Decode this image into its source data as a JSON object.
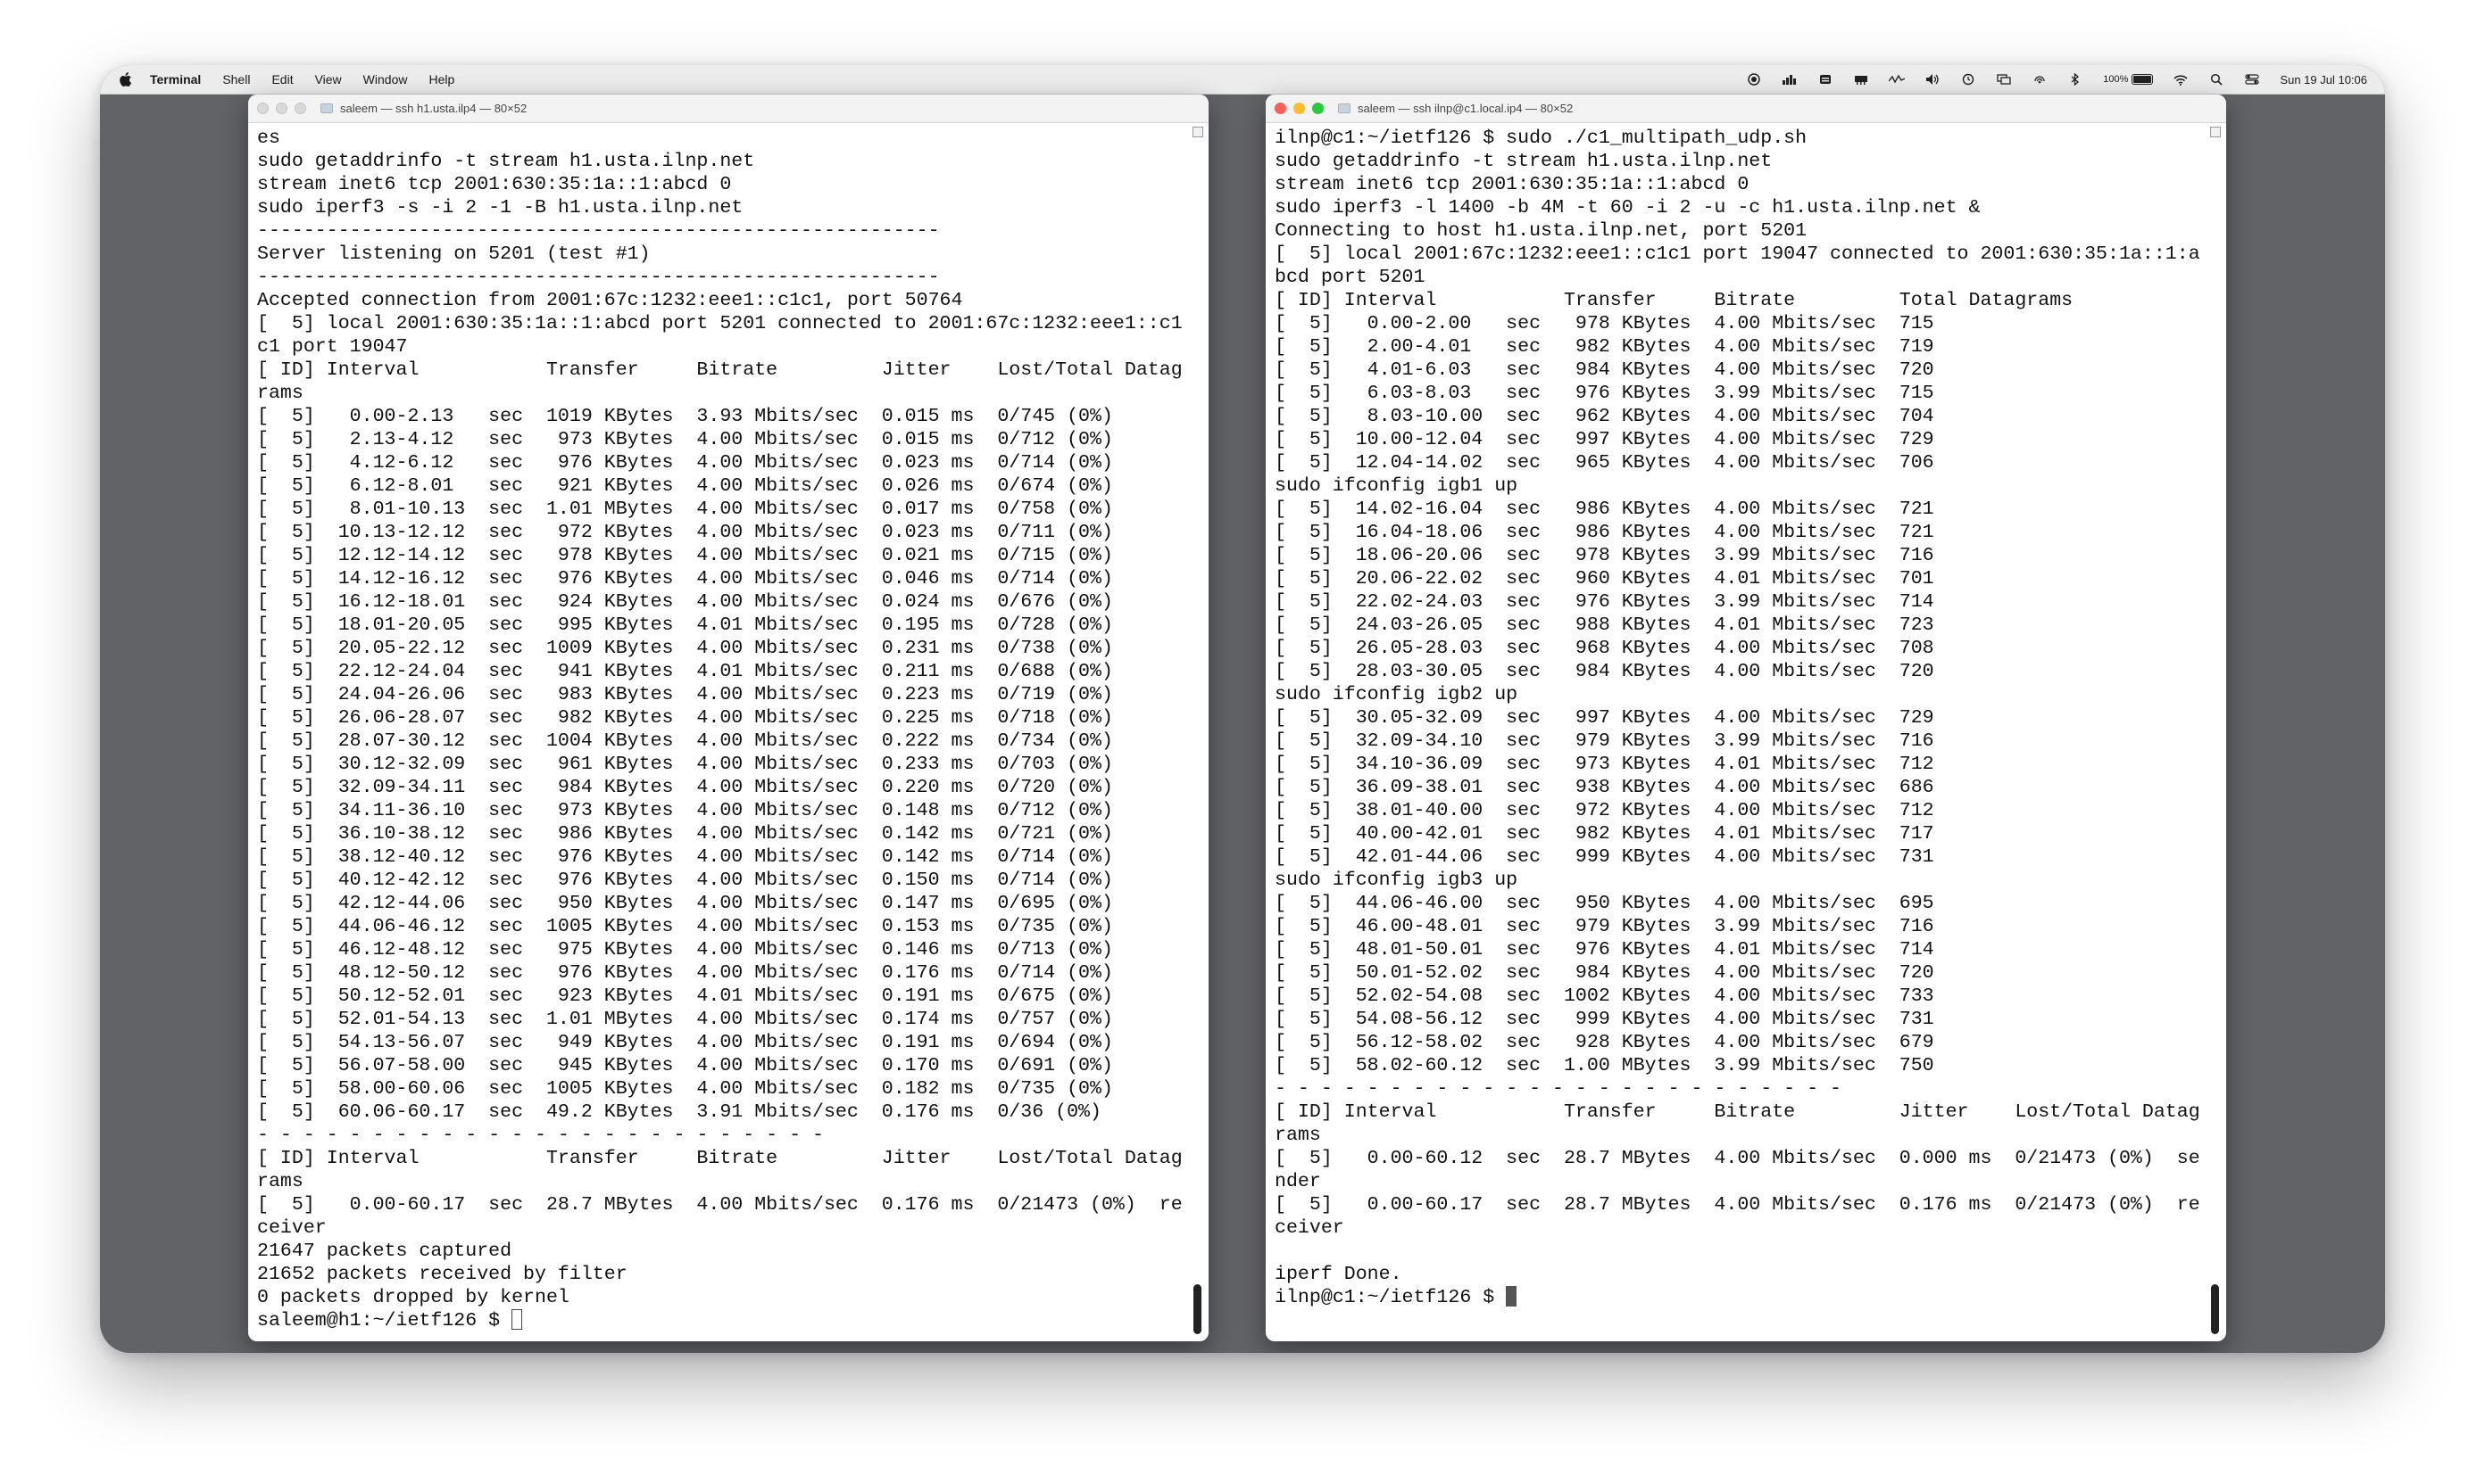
{
  "menubar": {
    "apple_icon": "apple-logo-icon",
    "items": [
      "Terminal",
      "Shell",
      "Edit",
      "View",
      "Window",
      "Help"
    ],
    "battery": "100%",
    "clock": "Sun 19 Jul  10:06"
  },
  "left_window": {
    "title": "saleem — ssh h1.usta.ilp4 — 80×52",
    "lines": [
      "es",
      "sudo getaddrinfo -t stream h1.usta.ilnp.net",
      "stream inet6 tcp 2001:630:35:1a::1:abcd 0",
      "sudo iperf3 -s -i 2 -1 -B h1.usta.ilnp.net",
      "-----------------------------------------------------------",
      "Server listening on 5201 (test #1)",
      "-----------------------------------------------------------",
      "Accepted connection from 2001:67c:1232:eee1::c1c1, port 50764",
      "[  5] local 2001:630:35:1a::1:abcd port 5201 connected to 2001:67c:1232:eee1::c1",
      "c1 port 19047",
      "[ ID] Interval           Transfer     Bitrate         Jitter    Lost/Total Datag",
      "rams",
      "[  5]   0.00-2.13   sec  1019 KBytes  3.93 Mbits/sec  0.015 ms  0/745 (0%)",
      "[  5]   2.13-4.12   sec   973 KBytes  4.00 Mbits/sec  0.015 ms  0/712 (0%)",
      "[  5]   4.12-6.12   sec   976 KBytes  4.00 Mbits/sec  0.023 ms  0/714 (0%)",
      "[  5]   6.12-8.01   sec   921 KBytes  4.00 Mbits/sec  0.026 ms  0/674 (0%)",
      "[  5]   8.01-10.13  sec  1.01 MBytes  4.00 Mbits/sec  0.017 ms  0/758 (0%)",
      "[  5]  10.13-12.12  sec   972 KBytes  4.00 Mbits/sec  0.023 ms  0/711 (0%)",
      "[  5]  12.12-14.12  sec   978 KBytes  4.00 Mbits/sec  0.021 ms  0/715 (0%)",
      "[  5]  14.12-16.12  sec   976 KBytes  4.00 Mbits/sec  0.046 ms  0/714 (0%)",
      "[  5]  16.12-18.01  sec   924 KBytes  4.00 Mbits/sec  0.024 ms  0/676 (0%)",
      "[  5]  18.01-20.05  sec   995 KBytes  4.01 Mbits/sec  0.195 ms  0/728 (0%)",
      "[  5]  20.05-22.12  sec  1009 KBytes  4.00 Mbits/sec  0.231 ms  0/738 (0%)",
      "[  5]  22.12-24.04  sec   941 KBytes  4.01 Mbits/sec  0.211 ms  0/688 (0%)",
      "[  5]  24.04-26.06  sec   983 KBytes  4.00 Mbits/sec  0.223 ms  0/719 (0%)",
      "[  5]  26.06-28.07  sec   982 KBytes  4.00 Mbits/sec  0.225 ms  0/718 (0%)",
      "[  5]  28.07-30.12  sec  1004 KBytes  4.00 Mbits/sec  0.222 ms  0/734 (0%)",
      "[  5]  30.12-32.09  sec   961 KBytes  4.00 Mbits/sec  0.233 ms  0/703 (0%)",
      "[  5]  32.09-34.11  sec   984 KBytes  4.00 Mbits/sec  0.220 ms  0/720 (0%)",
      "[  5]  34.11-36.10  sec   973 KBytes  4.00 Mbits/sec  0.148 ms  0/712 (0%)",
      "[  5]  36.10-38.12  sec   986 KBytes  4.00 Mbits/sec  0.142 ms  0/721 (0%)",
      "[  5]  38.12-40.12  sec   976 KBytes  4.00 Mbits/sec  0.142 ms  0/714 (0%)",
      "[  5]  40.12-42.12  sec   976 KBytes  4.00 Mbits/sec  0.150 ms  0/714 (0%)",
      "[  5]  42.12-44.06  sec   950 KBytes  4.00 Mbits/sec  0.147 ms  0/695 (0%)",
      "[  5]  44.06-46.12  sec  1005 KBytes  4.00 Mbits/sec  0.153 ms  0/735 (0%)",
      "[  5]  46.12-48.12  sec   975 KBytes  4.00 Mbits/sec  0.146 ms  0/713 (0%)",
      "[  5]  48.12-50.12  sec   976 KBytes  4.00 Mbits/sec  0.176 ms  0/714 (0%)",
      "[  5]  50.12-52.01  sec   923 KBytes  4.01 Mbits/sec  0.191 ms  0/675 (0%)",
      "[  5]  52.01-54.13  sec  1.01 MBytes  4.00 Mbits/sec  0.174 ms  0/757 (0%)",
      "[  5]  54.13-56.07  sec   949 KBytes  4.00 Mbits/sec  0.191 ms  0/694 (0%)",
      "[  5]  56.07-58.00  sec   945 KBytes  4.00 Mbits/sec  0.170 ms  0/691 (0%)",
      "[  5]  58.00-60.06  sec  1005 KBytes  4.00 Mbits/sec  0.182 ms  0/735 (0%)",
      "[  5]  60.06-60.17  sec  49.2 KBytes  3.91 Mbits/sec  0.176 ms  0/36 (0%)",
      "- - - - - - - - - - - - - - - - - - - - - - - - -",
      "[ ID] Interval           Transfer     Bitrate         Jitter    Lost/Total Datag",
      "rams",
      "[  5]   0.00-60.17  sec  28.7 MBytes  4.00 Mbits/sec  0.176 ms  0/21473 (0%)  re",
      "ceiver",
      "21647 packets captured",
      "21652 packets received by filter",
      "0 packets dropped by kernel"
    ],
    "prompt": "saleem@h1:~/ietf126 $ "
  },
  "right_window": {
    "title": "saleem — ssh ilnp@c1.local.ip4 — 80×52",
    "lines": [
      "ilnp@c1:~/ietf126 $ sudo ./c1_multipath_udp.sh",
      "sudo getaddrinfo -t stream h1.usta.ilnp.net",
      "stream inet6 tcp 2001:630:35:1a::1:abcd 0",
      "sudo iperf3 -l 1400 -b 4M -t 60 -i 2 -u -c h1.usta.ilnp.net &",
      "Connecting to host h1.usta.ilnp.net, port 5201",
      "[  5] local 2001:67c:1232:eee1::c1c1 port 19047 connected to 2001:630:35:1a::1:a",
      "bcd port 5201",
      "[ ID] Interval           Transfer     Bitrate         Total Datagrams",
      "[  5]   0.00-2.00   sec   978 KBytes  4.00 Mbits/sec  715",
      "[  5]   2.00-4.01   sec   982 KBytes  4.00 Mbits/sec  719",
      "[  5]   4.01-6.03   sec   984 KBytes  4.00 Mbits/sec  720",
      "[  5]   6.03-8.03   sec   976 KBytes  3.99 Mbits/sec  715",
      "[  5]   8.03-10.00  sec   962 KBytes  4.00 Mbits/sec  704",
      "[  5]  10.00-12.04  sec   997 KBytes  4.00 Mbits/sec  729",
      "[  5]  12.04-14.02  sec   965 KBytes  4.00 Mbits/sec  706",
      "sudo ifconfig igb1 up",
      "[  5]  14.02-16.04  sec   986 KBytes  4.00 Mbits/sec  721",
      "[  5]  16.04-18.06  sec   986 KBytes  4.00 Mbits/sec  721",
      "[  5]  18.06-20.06  sec   978 KBytes  3.99 Mbits/sec  716",
      "[  5]  20.06-22.02  sec   960 KBytes  4.01 Mbits/sec  701",
      "[  5]  22.02-24.03  sec   976 KBytes  3.99 Mbits/sec  714",
      "[  5]  24.03-26.05  sec   988 KBytes  4.01 Mbits/sec  723",
      "[  5]  26.05-28.03  sec   968 KBytes  4.00 Mbits/sec  708",
      "[  5]  28.03-30.05  sec   984 KBytes  4.00 Mbits/sec  720",
      "sudo ifconfig igb2 up",
      "[  5]  30.05-32.09  sec   997 KBytes  4.00 Mbits/sec  729",
      "[  5]  32.09-34.10  sec   979 KBytes  3.99 Mbits/sec  716",
      "[  5]  34.10-36.09  sec   973 KBytes  4.01 Mbits/sec  712",
      "[  5]  36.09-38.01  sec   938 KBytes  4.00 Mbits/sec  686",
      "[  5]  38.01-40.00  sec   972 KBytes  4.00 Mbits/sec  712",
      "[  5]  40.00-42.01  sec   982 KBytes  4.01 Mbits/sec  717",
      "[  5]  42.01-44.06  sec   999 KBytes  4.00 Mbits/sec  731",
      "sudo ifconfig igb3 up",
      "[  5]  44.06-46.00  sec   950 KBytes  4.00 Mbits/sec  695",
      "[  5]  46.00-48.01  sec   979 KBytes  3.99 Mbits/sec  716",
      "[  5]  48.01-50.01  sec   976 KBytes  4.01 Mbits/sec  714",
      "[  5]  50.01-52.02  sec   984 KBytes  4.00 Mbits/sec  720",
      "[  5]  52.02-54.08  sec  1002 KBytes  4.00 Mbits/sec  733",
      "[  5]  54.08-56.12  sec   999 KBytes  4.00 Mbits/sec  731",
      "[  5]  56.12-58.02  sec   928 KBytes  4.00 Mbits/sec  679",
      "[  5]  58.02-60.12  sec  1.00 MBytes  3.99 Mbits/sec  750",
      "- - - - - - - - - - - - - - - - - - - - - - - - -",
      "[ ID] Interval           Transfer     Bitrate         Jitter    Lost/Total Datag",
      "rams",
      "[  5]   0.00-60.12  sec  28.7 MBytes  4.00 Mbits/sec  0.000 ms  0/21473 (0%)  se",
      "nder",
      "[  5]   0.00-60.17  sec  28.7 MBytes  4.00 Mbits/sec  0.176 ms  0/21473 (0%)  re",
      "ceiver",
      "",
      "iperf Done."
    ],
    "prompt": "ilnp@c1:~/ietf126 $ "
  }
}
